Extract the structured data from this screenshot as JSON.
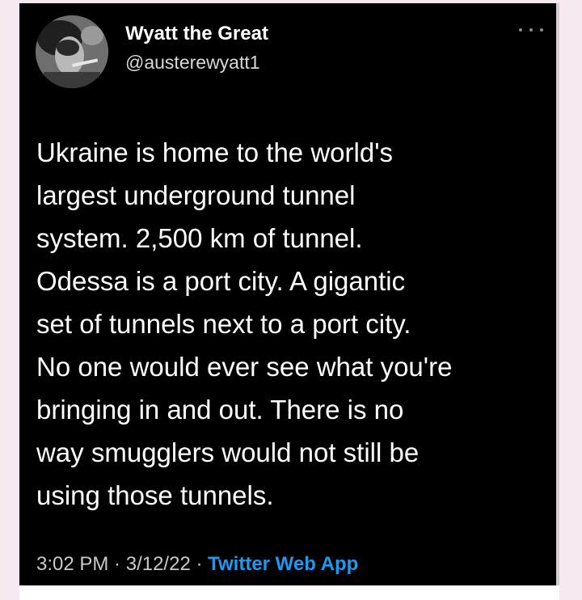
{
  "tweet": {
    "display_name": "Wyatt the Great",
    "handle": "@austerewyatt1",
    "avatar_icon": "user-avatar",
    "more_icon": "ellipsis-icon",
    "text": "Ukraine is home to the world's\nlargest underground tunnel\nsystem. 2,500 km of tunnel.\nOdessa is a port city. A gigantic\nset of tunnels next to a port city.\nNo one would ever see what you're\nbringing in and out. There is no\nway smugglers would not still be\nusing those tunnels.",
    "time": "3:02 PM",
    "separator": " · ",
    "date": "3/12/22",
    "source": "Twitter Web App"
  },
  "colors": {
    "background": "#000000",
    "text": "#ffffff",
    "meta": "#c9c9c9",
    "link": "#1d9bf0",
    "outer": "#f7e9f1"
  }
}
